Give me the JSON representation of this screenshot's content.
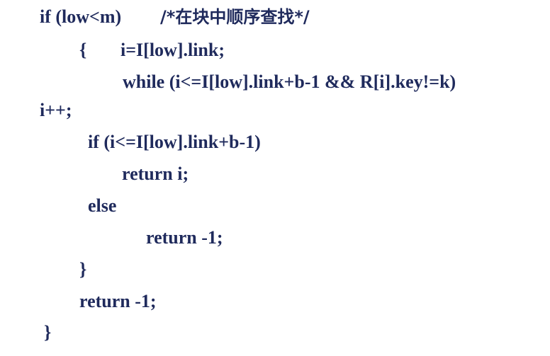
{
  "code": {
    "line1": "if (low<m)",
    "line1_comment": "/*在块中顺序查找*/",
    "line2_brace": "{",
    "line2": "i=I[low].link;",
    "line3": "while (i<=I[low].link+b-1 && R[i].key!=k)",
    "line4": "i++;",
    "line5": "if (i<=I[low].link+b-1)",
    "line6": "return i;",
    "line7": "else",
    "line8": "return -1;",
    "line9": "}",
    "line10": "return -1;",
    "line11": "}"
  },
  "colors": {
    "text": "#1f2a5c",
    "background": "#ffffff"
  }
}
